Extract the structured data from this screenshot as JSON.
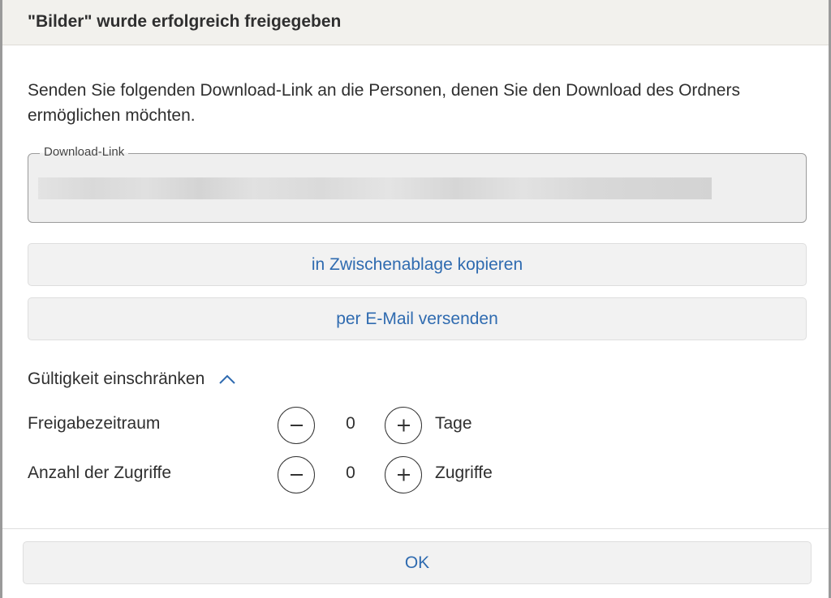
{
  "dialog": {
    "title": "\"Bilder\" wurde erfolgreich freigegeben",
    "description": "Senden Sie folgenden Download-Link an die Personen, denen Sie den Download des Ordners ermöglichen möchten."
  },
  "link_field": {
    "legend": "Download-Link",
    "value": ""
  },
  "buttons": {
    "copy_label": "in Zwischenablage kopieren",
    "email_label": "per E-Mail versenden",
    "ok_label": "OK"
  },
  "restriction": {
    "toggle_label": "Gültigkeit einschränken",
    "toggle_icon": "chevron-up-icon",
    "rows": [
      {
        "label": "Freigabezeitraum",
        "value": "0",
        "unit": "Tage"
      },
      {
        "label": "Anzahl der Zugriffe",
        "value": "0",
        "unit": "Zugriffe"
      }
    ]
  },
  "colors": {
    "accent": "#2f6bb0",
    "header_bg": "#f2f1ed",
    "button_bg": "#f2f2f2"
  }
}
